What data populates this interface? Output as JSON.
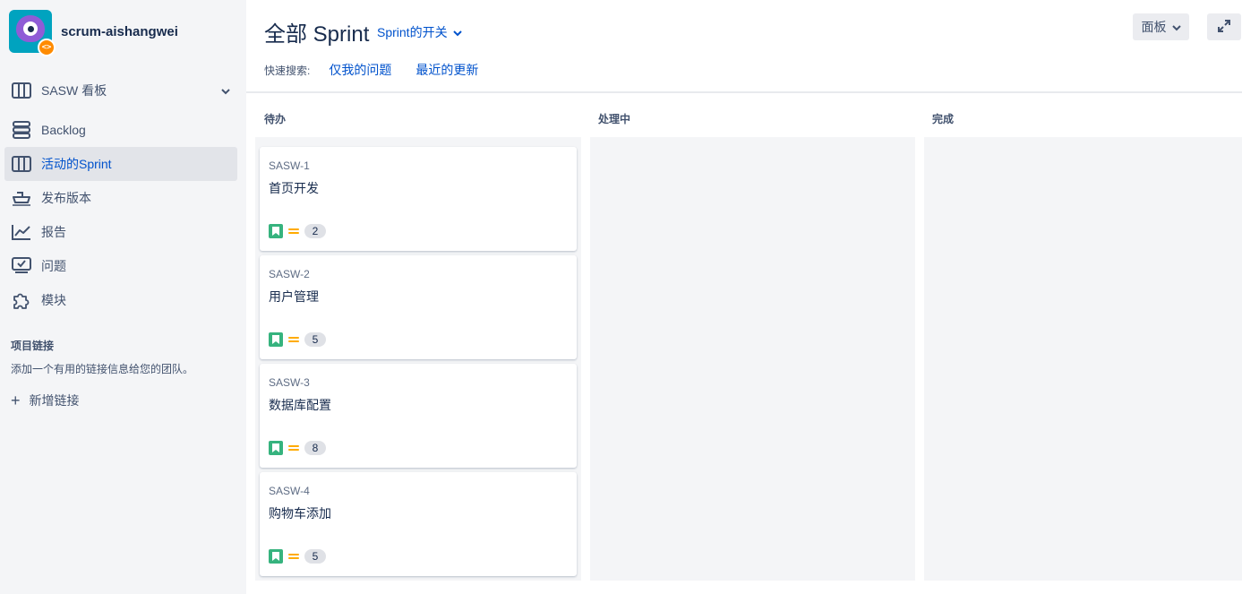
{
  "project": {
    "name": "scrum-aishangwei",
    "badge_icon": "code-icon"
  },
  "sidebar": {
    "board_selector": {
      "label": "SASW 看板",
      "icon": "board-icon"
    },
    "items": [
      {
        "label": "Backlog",
        "icon": "backlog-icon"
      },
      {
        "label": "活动的Sprint",
        "icon": "board-icon",
        "active": true
      },
      {
        "label": "发布版本",
        "icon": "ship-icon"
      },
      {
        "label": "报告",
        "icon": "chart-icon"
      },
      {
        "label": "问题",
        "icon": "issues-icon"
      },
      {
        "label": "模块",
        "icon": "puzzle-icon"
      }
    ],
    "project_links": {
      "title": "项目链接",
      "description": "添加一个有用的链接信息给您的团队。",
      "add_label": "新增链接"
    }
  },
  "header": {
    "title": "全部 Sprint",
    "sprint_toggle": "Sprint的开关",
    "board_button": "面板",
    "quick_search": {
      "label": "快速搜索:",
      "links": [
        "仅我的问题",
        "最近的更新"
      ]
    }
  },
  "board": {
    "columns": [
      {
        "name": "待办",
        "cards": [
          {
            "key": "SASW-1",
            "summary": "首页开发",
            "points": "2"
          },
          {
            "key": "SASW-2",
            "summary": "用户管理",
            "points": "5"
          },
          {
            "key": "SASW-3",
            "summary": "数据库配置",
            "points": "8"
          },
          {
            "key": "SASW-4",
            "summary": "购物车添加",
            "points": "5"
          }
        ]
      },
      {
        "name": "处理中",
        "cards": []
      },
      {
        "name": "完成",
        "cards": []
      }
    ]
  },
  "colors": {
    "accent": "#0052cc",
    "story": "#36b37e",
    "priority_medium": "#ffab00",
    "sidebar_bg": "#f4f5f7"
  }
}
